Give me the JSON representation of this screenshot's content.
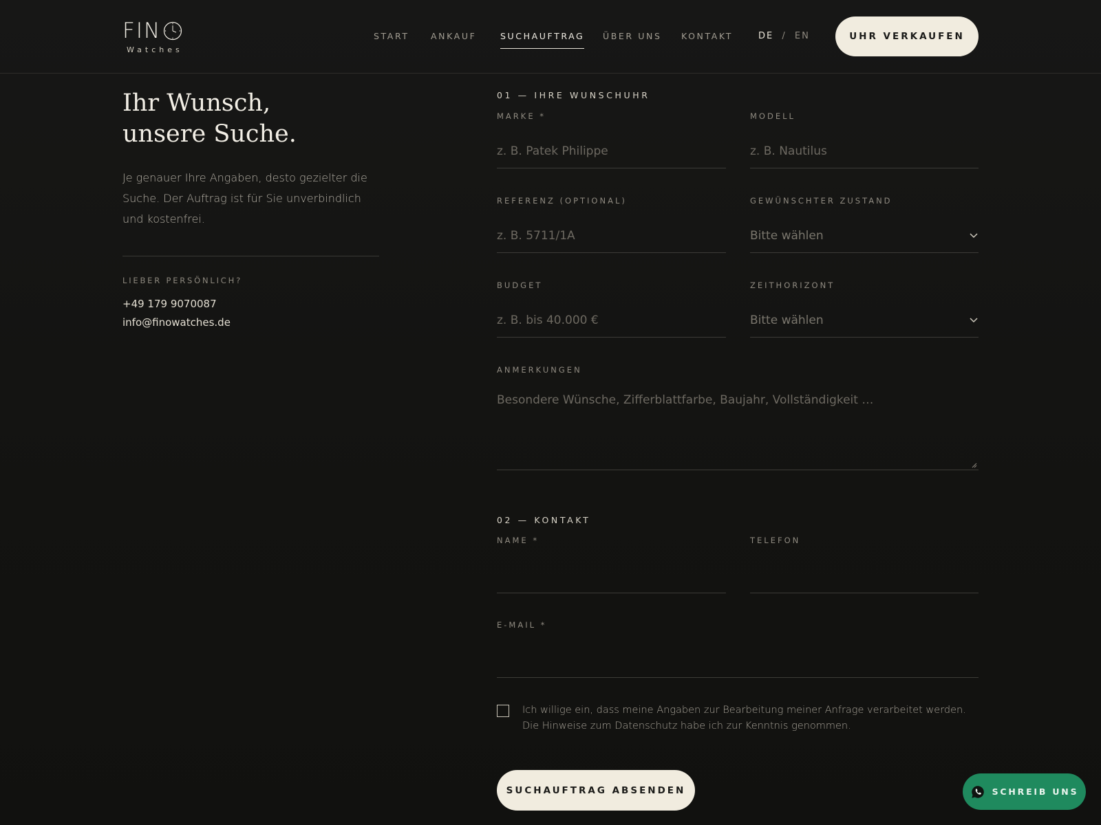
{
  "header": {
    "logo_text": "FIN",
    "logo_sub": "Watches",
    "nav": [
      {
        "label": "START"
      },
      {
        "label": "ANKAUF"
      },
      {
        "label": "SUCHAUFTRAG"
      },
      {
        "label": "ÜBER UNS"
      },
      {
        "label": "KONTAKT"
      }
    ],
    "active_nav": "SUCHAUFTRAG",
    "lang_de": "DE",
    "lang_sep": "/",
    "lang_en": "EN",
    "cta_label": "UHR VERKAUFEN"
  },
  "intro": {
    "headline_line1": "Ihr Wunsch,",
    "headline_line2": "unsere Suche.",
    "text": "Je genauer Ihre Angaben, desto gezielter die Suche. Der Auftrag ist für Sie unverbindlich und kostenfrei.",
    "personal_label": "LIEBER PERSÖNLICH?",
    "phone": "+49 179 9070087",
    "email": "info@finowatches.de"
  },
  "form": {
    "section1_title": "01 — IHRE WUNSCHUHR",
    "marke_label": "MARKE *",
    "marke_placeholder": "z. B. Patek Philippe",
    "modell_label": "MODELL",
    "modell_placeholder": "z. B. Nautilus",
    "referenz_label": "REFERENZ (OPTIONAL)",
    "referenz_placeholder": "z. B. 5711/1A",
    "zustand_label": "GEWÜNSCHTER ZUSTAND",
    "zustand_value": "Bitte wählen",
    "budget_label": "BUDGET",
    "budget_placeholder": "z. B. bis 40.000 €",
    "zeithorizont_label": "ZEITHORIZONT",
    "zeithorizont_value": "Bitte wählen",
    "anmerkungen_label": "ANMERKUNGEN",
    "anmerkungen_placeholder": "Besondere Wünsche, Zifferblattfarbe, Baujahr, Vollständigkeit …",
    "section2_title": "02 — KONTAKT",
    "name_label": "NAME *",
    "telefon_label": "TELEFON",
    "email_label": "E-MAIL *",
    "consent_text": "Ich willige ein, dass meine Angaben zur Bearbeitung meiner Anfrage verarbeitet werden. Die Hinweise zum Datenschutz habe ich zur Kenntnis genommen.",
    "consent_checked": false,
    "submit_label": "SUCHAUFTRAG ABSENDEN"
  },
  "whatsapp": {
    "label": "SCHREIB UNS",
    "icon": "whatsapp-icon",
    "color": "#1f8a5e"
  },
  "colors": {
    "background": "#141412",
    "accent_button": "#f1ecdf",
    "text": "#e9e4d8"
  }
}
